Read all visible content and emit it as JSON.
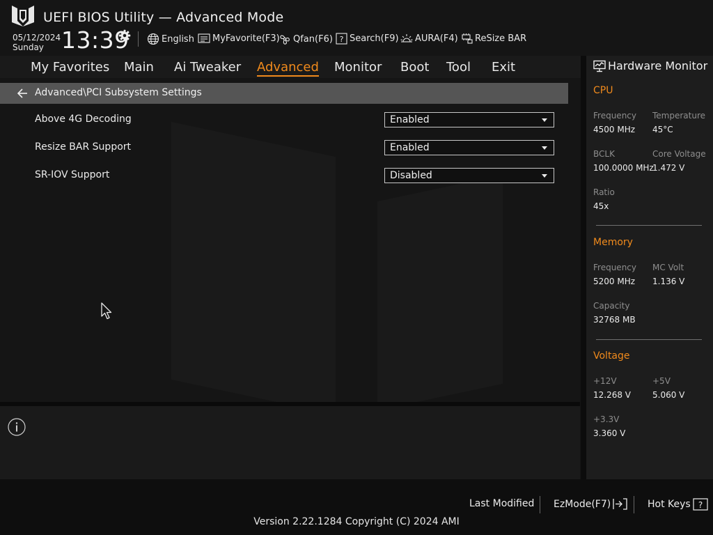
{
  "header": {
    "title": "UEFI BIOS Utility — Advanced Mode",
    "date": "05/12/2024",
    "day": "Sunday",
    "time": "13:39",
    "tools": [
      {
        "label": "English",
        "icon": "globe-icon"
      },
      {
        "label": "MyFavorite(F3)",
        "icon": "favorite-list-icon"
      },
      {
        "label": "Qfan(F6)",
        "icon": "fan-icon"
      },
      {
        "label": "Search(F9)",
        "icon": "search-help-icon"
      },
      {
        "label": "AURA(F4)",
        "icon": "aura-light-icon"
      },
      {
        "label": "ReSize BAR",
        "icon": "resize-bar-icon"
      }
    ]
  },
  "nav": {
    "tabs": [
      {
        "label": "My Favorites"
      },
      {
        "label": "Main"
      },
      {
        "label": "Ai Tweaker"
      },
      {
        "label": "Advanced",
        "active": true
      },
      {
        "label": "Monitor"
      },
      {
        "label": "Boot"
      },
      {
        "label": "Tool"
      },
      {
        "label": "Exit"
      }
    ]
  },
  "breadcrumb": "Advanced\\PCI Subsystem Settings",
  "settings": [
    {
      "label": "Above 4G Decoding",
      "value": "Enabled"
    },
    {
      "label": "Resize BAR Support",
      "value": "Enabled"
    },
    {
      "label": "SR-IOV Support",
      "value": "Disabled"
    }
  ],
  "hardware_monitor": {
    "title": "Hardware Monitor",
    "cpu": {
      "title": "CPU",
      "frequency_label": "Frequency",
      "frequency": "4500 MHz",
      "temperature_label": "Temperature",
      "temperature": "45°C",
      "bclk_label": "BCLK",
      "bclk": "100.0000 MHz",
      "core_voltage_label": "Core Voltage",
      "core_voltage": "1.472 V",
      "ratio_label": "Ratio",
      "ratio": "45x"
    },
    "memory": {
      "title": "Memory",
      "frequency_label": "Frequency",
      "frequency": "5200 MHz",
      "mc_volt_label": "MC Volt",
      "mc_volt": "1.136 V",
      "capacity_label": "Capacity",
      "capacity": "32768 MB"
    },
    "voltage": {
      "title": "Voltage",
      "v12_label": "+12V",
      "v12": "12.268 V",
      "v5_label": "+5V",
      "v5": "5.060 V",
      "v33_label": "+3.3V",
      "v33": "3.360 V"
    }
  },
  "footer": {
    "last_modified": "Last Modified",
    "ezmode": "EzMode(F7)",
    "hotkeys": "Hot Keys",
    "version": "Version 2.22.1284 Copyright (C) 2024 AMI"
  },
  "colors": {
    "accent": "#f08a1c",
    "background": "#151515",
    "breadcrumb_bar": "#555555"
  }
}
